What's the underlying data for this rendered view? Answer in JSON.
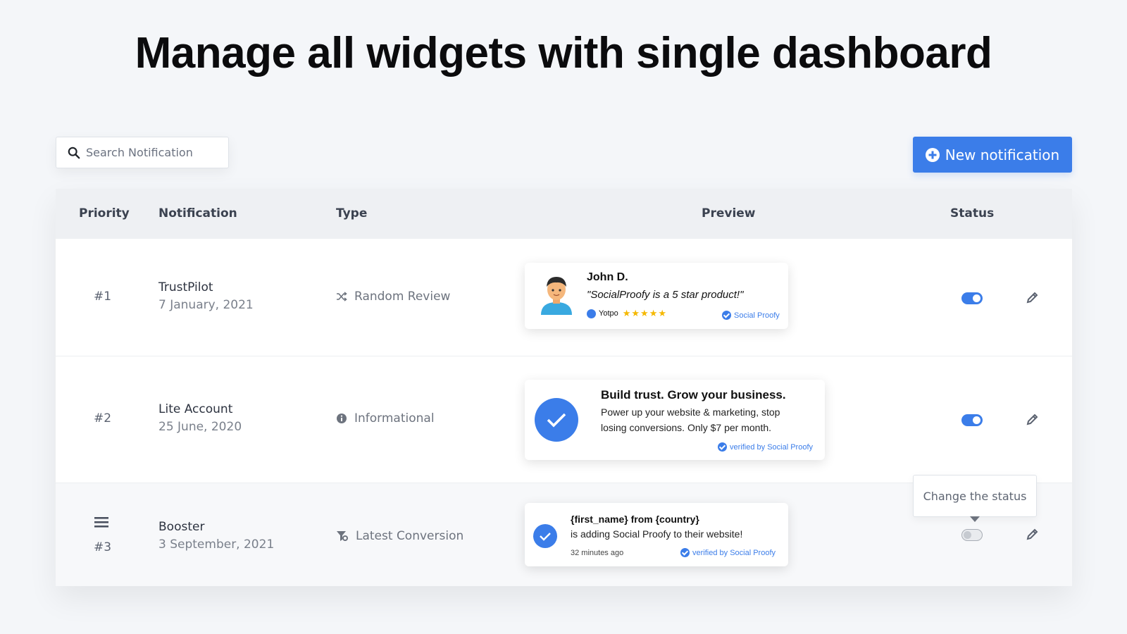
{
  "headline": "Manage all widgets with single dashboard",
  "search": {
    "placeholder": "Search Notification",
    "icon": "search-icon"
  },
  "new_button": {
    "label": "New notification",
    "icon": "plus-circle-icon"
  },
  "table": {
    "headers": {
      "priority": "Priority",
      "notification": "Notification",
      "type": "Type",
      "preview": "Preview",
      "status": "Status"
    },
    "rows": [
      {
        "priority": "#1",
        "name": "TrustPilot",
        "date": "7 January, 2021",
        "type": "Random Review",
        "type_icon": "shuffle-icon",
        "status": "on",
        "preview": {
          "name": "John D.",
          "quote": "\"SocialProofy is a 5 star product!\"",
          "source": "Yotpo",
          "stars": 5,
          "verified": "Social Proofy"
        }
      },
      {
        "priority": "#2",
        "name": "Lite Account",
        "date": "25 June, 2020",
        "type": "Informational",
        "type_icon": "info-icon",
        "status": "on",
        "preview": {
          "title": "Build trust. Grow your business.",
          "line1": "Power up your website & marketing, stop",
          "line2": "losing conversions. Only $7 per month.",
          "verified": "verified by Social Proofy"
        }
      },
      {
        "priority": "#3",
        "name": "Booster",
        "date": "3 September, 2021",
        "type": "Latest Conversion",
        "type_icon": "funnel-icon",
        "status": "off",
        "preview": {
          "title": "{first_name} from {country}",
          "line1": "is adding Social Proofy to their website!",
          "time": "32 minutes ago",
          "verified": "verified by Social Proofy"
        }
      }
    ]
  },
  "tooltip": "Change the status",
  "colors": {
    "accent": "#3b7de9",
    "background": "#f4f6f9",
    "header_bg": "#eef0f3",
    "star": "#f5b800"
  }
}
